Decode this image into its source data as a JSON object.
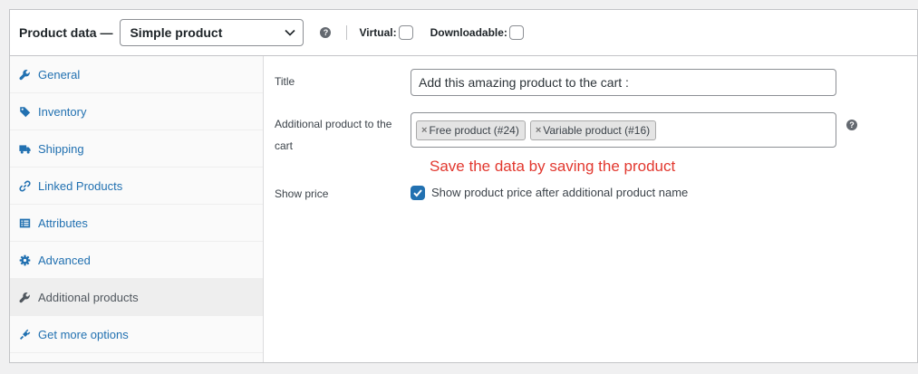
{
  "header": {
    "title": "Product data —",
    "product_type": "Simple product",
    "help_glyph": "?",
    "virtual_label": "Virtual:",
    "downloadable_label": "Downloadable:",
    "virtual_checked": false,
    "downloadable_checked": false
  },
  "sidebar": {
    "items": [
      {
        "label": "General",
        "icon": "wrench-icon",
        "active": false
      },
      {
        "label": "Inventory",
        "icon": "tag-icon",
        "active": false
      },
      {
        "label": "Shipping",
        "icon": "truck-icon",
        "active": false
      },
      {
        "label": "Linked Products",
        "icon": "link-icon",
        "active": false
      },
      {
        "label": "Attributes",
        "icon": "list-icon",
        "active": false
      },
      {
        "label": "Advanced",
        "icon": "gear-icon",
        "active": false
      },
      {
        "label": "Additional products",
        "icon": "wrench-icon",
        "active": true
      },
      {
        "label": "Get more options",
        "icon": "plugin-icon",
        "active": false
      }
    ]
  },
  "form": {
    "title_label": "Title",
    "title_value": "Add this amazing product to the cart :",
    "additional_label_line1": "Additional product to the",
    "additional_label_line2": "cart",
    "chips": [
      {
        "remove": "×",
        "label": "Free product (#24)"
      },
      {
        "remove": "×",
        "label": "Variable product (#16)"
      }
    ],
    "help_glyph": "?",
    "notice": "Save the data by saving the product",
    "show_price_label": "Show price",
    "show_price_checked": true,
    "show_price_text": "Show product price after additional product name"
  },
  "colors": {
    "link": "#2271b1",
    "notice": "#e2382f",
    "active_bg": "#eeeeee",
    "page_bg": "#f0f0f1"
  }
}
